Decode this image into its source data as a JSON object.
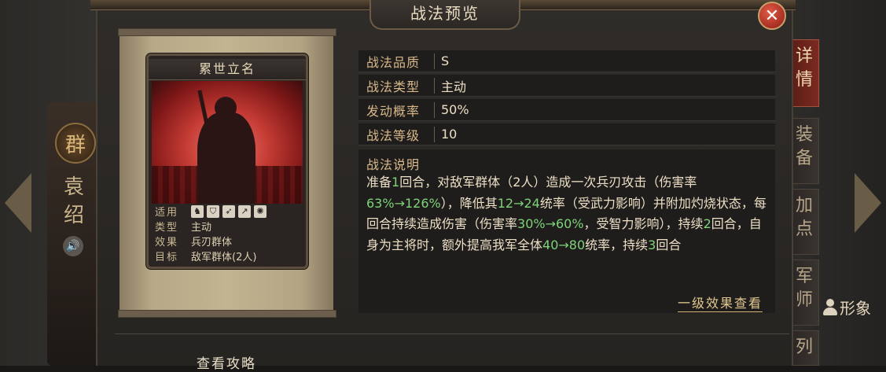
{
  "window": {
    "title": "战法预览"
  },
  "hero": {
    "faction": "群",
    "name": "袁绍"
  },
  "tabs": [
    {
      "label": "详情",
      "active": true
    },
    {
      "label": "装备",
      "active": false
    },
    {
      "label": "加点",
      "active": false
    },
    {
      "label": "军师",
      "active": false
    },
    {
      "label": "列",
      "active": false
    }
  ],
  "appearance_label": "形象",
  "card": {
    "title": "累世立名",
    "rows": [
      {
        "key": "适用",
        "value": ""
      },
      {
        "key": "类型",
        "value": "主动"
      },
      {
        "key": "效果",
        "value": "兵刃群体"
      },
      {
        "key": "目标",
        "value": "敌军群体(2人)"
      }
    ],
    "equip_icons": [
      "cavalry-icon",
      "shield-icon",
      "bow-icon",
      "spear-icon",
      "wheel-icon"
    ]
  },
  "info": [
    {
      "label": "战法品质",
      "value": "S"
    },
    {
      "label": "战法类型",
      "value": "主动"
    },
    {
      "label": "发动概率",
      "value": "50%"
    },
    {
      "label": "战法等级",
      "value": "10"
    }
  ],
  "description": {
    "label": "战法说明",
    "segments": [
      {
        "text": "准备",
        "hl": false
      },
      {
        "text": "1",
        "hl": true
      },
      {
        "text": "回合，对敌军群体（2人）造成一次兵刃攻击（伤害率",
        "hl": false
      },
      {
        "text": "63%→126%",
        "hl": true
      },
      {
        "text": "），降低其",
        "hl": false
      },
      {
        "text": "12→24",
        "hl": true
      },
      {
        "text": "统率（受武力影响）并附加灼烧状态，每回合持续造成伤害（伤害率",
        "hl": false
      },
      {
        "text": "30%→60%",
        "hl": true
      },
      {
        "text": "，受智力影响），持续",
        "hl": false
      },
      {
        "text": "2",
        "hl": true
      },
      {
        "text": "回合，自身为主将时，额外提高我军全体",
        "hl": false
      },
      {
        "text": "40→80",
        "hl": true
      },
      {
        "text": "统率，持续",
        "hl": false
      },
      {
        "text": "3",
        "hl": true
      },
      {
        "text": "回合",
        "hl": false
      }
    ]
  },
  "detail_link": "一级效果查看",
  "guide_link": "查看攻略",
  "colors": {
    "highlight": "#7ed37a",
    "label": "#d7b88a",
    "active_tab": "#7a2a20"
  }
}
